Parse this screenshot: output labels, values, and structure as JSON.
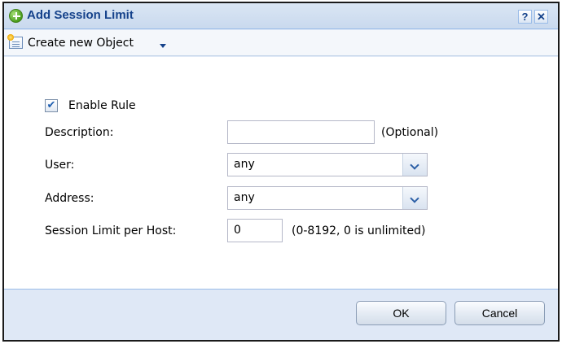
{
  "dialog": {
    "title": "Add Session Limit",
    "help_label": "?",
    "close_label": "✕"
  },
  "toolbar": {
    "create_label": "Create new Object"
  },
  "form": {
    "enable_label": "Enable Rule",
    "enable_checked": true,
    "description_label": "Description:",
    "description_value": "",
    "description_hint": "(Optional)",
    "user_label": "User:",
    "user_value": "any",
    "address_label": "Address:",
    "address_value": "any",
    "session_label": "Session Limit per Host:",
    "session_value": "0",
    "session_hint": "(0-8192, 0 is unlimited)"
  },
  "footer": {
    "ok_label": "OK",
    "cancel_label": "Cancel"
  },
  "icons": {
    "title": "add-circle-icon",
    "toolbar": "new-object-icon",
    "dropdown": "chevron-down-icon"
  },
  "colors": {
    "title_text": "#15428b",
    "panel_bg": "#dfe8f6",
    "border": "#99bbe8"
  }
}
